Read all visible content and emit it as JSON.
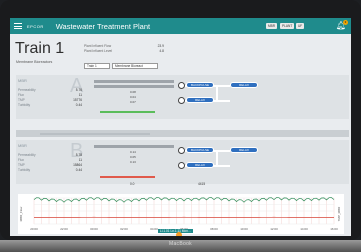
{
  "device": {
    "label": "MacBook"
  },
  "header": {
    "brand": "EPCOR",
    "title": "Wastewater Treatment Plant",
    "buttons": [
      "MBR",
      "PLANT",
      "UF"
    ],
    "notifications": "3"
  },
  "train": {
    "title": "Train 1",
    "subtitle": "Membrane Bioreactors",
    "influent_label_1": "Plant Influent Flow",
    "influent_value_1": "23.9",
    "influent_label_2": "Plant Influent Level",
    "influent_value_2": "4.8",
    "select_train": "Train 1",
    "select_mode": "Membrane Bioreact"
  },
  "mbr_a": {
    "label": "MBR",
    "letter": "A",
    "rows": [
      {
        "label": "Permeability",
        "value": "5.76"
      },
      {
        "label": "Flux",
        "value": "11"
      },
      {
        "label": "TMP",
        "value": "15776"
      },
      {
        "label": "Turbidity",
        "value": "0.44"
      }
    ],
    "table": [
      "0.08",
      "0.04",
      "0.07"
    ],
    "pills": [
      "BACKPULSE",
      "RELAX",
      "RELAX"
    ],
    "feed_label": "Air Scour",
    "feed_value": "6.6",
    "feed_flow": "4425"
  },
  "mbr_b": {
    "label": "MBR",
    "letter": "B",
    "rows": [
      {
        "label": "Permeability",
        "value": "5.78"
      },
      {
        "label": "Flux",
        "value": "11"
      },
      {
        "label": "TMP",
        "value": "15864"
      },
      {
        "label": "Turbidity",
        "value": "0.44"
      }
    ],
    "table": [
      "0.14",
      "0.05",
      "0.13"
    ],
    "pills": [
      "BACKPULSE",
      "RELAX",
      "RELAX"
    ],
    "feed_value": "0.0",
    "feed_flow": "4415"
  },
  "chart": {
    "ylabel_left": "MBR_Flow",
    "ylabel_right": "TMP_MBR",
    "footer": "Ll.1.01 Ln.1.11 Mon...",
    "time_labels": [
      "20:00",
      "22:00",
      "00:00",
      "02:00",
      "04:00",
      "06:00",
      "08:00",
      "10:00",
      "12:00",
      "14:00",
      "16:00"
    ]
  },
  "chart_data": {
    "type": "line",
    "title": "",
    "x": [
      "20:00",
      "22:00",
      "00:00",
      "02:00",
      "04:00",
      "06:00",
      "08:00",
      "10:00",
      "12:00",
      "14:00",
      "16:00"
    ],
    "series": [
      {
        "color": "#2e8b57",
        "values": [
          1.0,
          0.9,
          1.0,
          0.9,
          1.0,
          0.95,
          1.0,
          0.9,
          1.0,
          0.95,
          1.0
        ]
      },
      {
        "color": "#d9473a",
        "values": [
          0.25,
          0.25,
          0.26,
          0.25,
          0.25,
          0.26,
          0.25,
          0.25,
          0.26,
          0.25,
          0.25
        ]
      }
    ],
    "grid": true
  }
}
